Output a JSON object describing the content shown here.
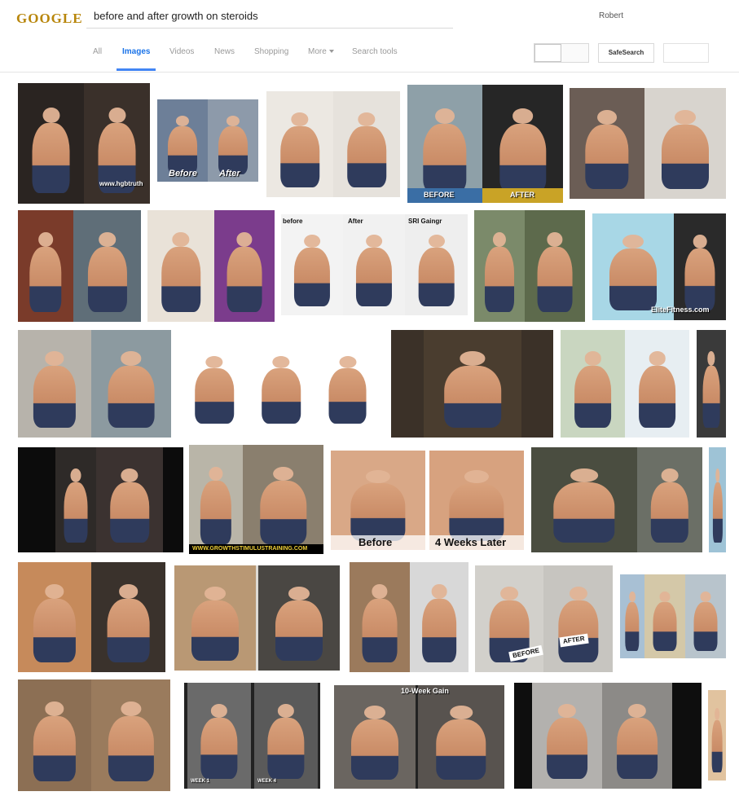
{
  "header": {
    "logo_text": "GOOGLE",
    "search_query": "before and after growth on steroids",
    "user_name": "Robert"
  },
  "nav": {
    "tabs": [
      {
        "label": "All",
        "active": false
      },
      {
        "label": "Images",
        "active": true
      },
      {
        "label": "Videos",
        "active": false
      },
      {
        "label": "News",
        "active": false
      },
      {
        "label": "Shopping",
        "active": false
      },
      {
        "label": "More",
        "active": false
      },
      {
        "label": "Search tools",
        "active": false
      }
    ],
    "safesearch_label": "SafeSearch"
  },
  "captions": {
    "r1_before": "Before",
    "r1_after": "After",
    "r1_watermark": "www.hgbtruth",
    "r1_before_caps": "BEFORE",
    "r1_after_caps": "AFTER",
    "r2_before": "before",
    "r2_after": "After",
    "r2_label3": "SRI Gaingr",
    "r2_elite": "EliteFitness.com",
    "r4_growth": "WWW.GROWTHSTIMULUSTRAINING.COM",
    "r4_before": "Before",
    "r4_later": "4 Weeks Later",
    "r5_before": "BEFORE",
    "r5_after": "AFTER",
    "r6_gain": "10-Week Gain",
    "r6_week": "WEEK 1",
    "r6_week4": "WEEK 4"
  },
  "colors": {
    "accent": "#4285f4",
    "tab_inactive": "#9a9a9a",
    "divider": "#e5e5e5"
  }
}
